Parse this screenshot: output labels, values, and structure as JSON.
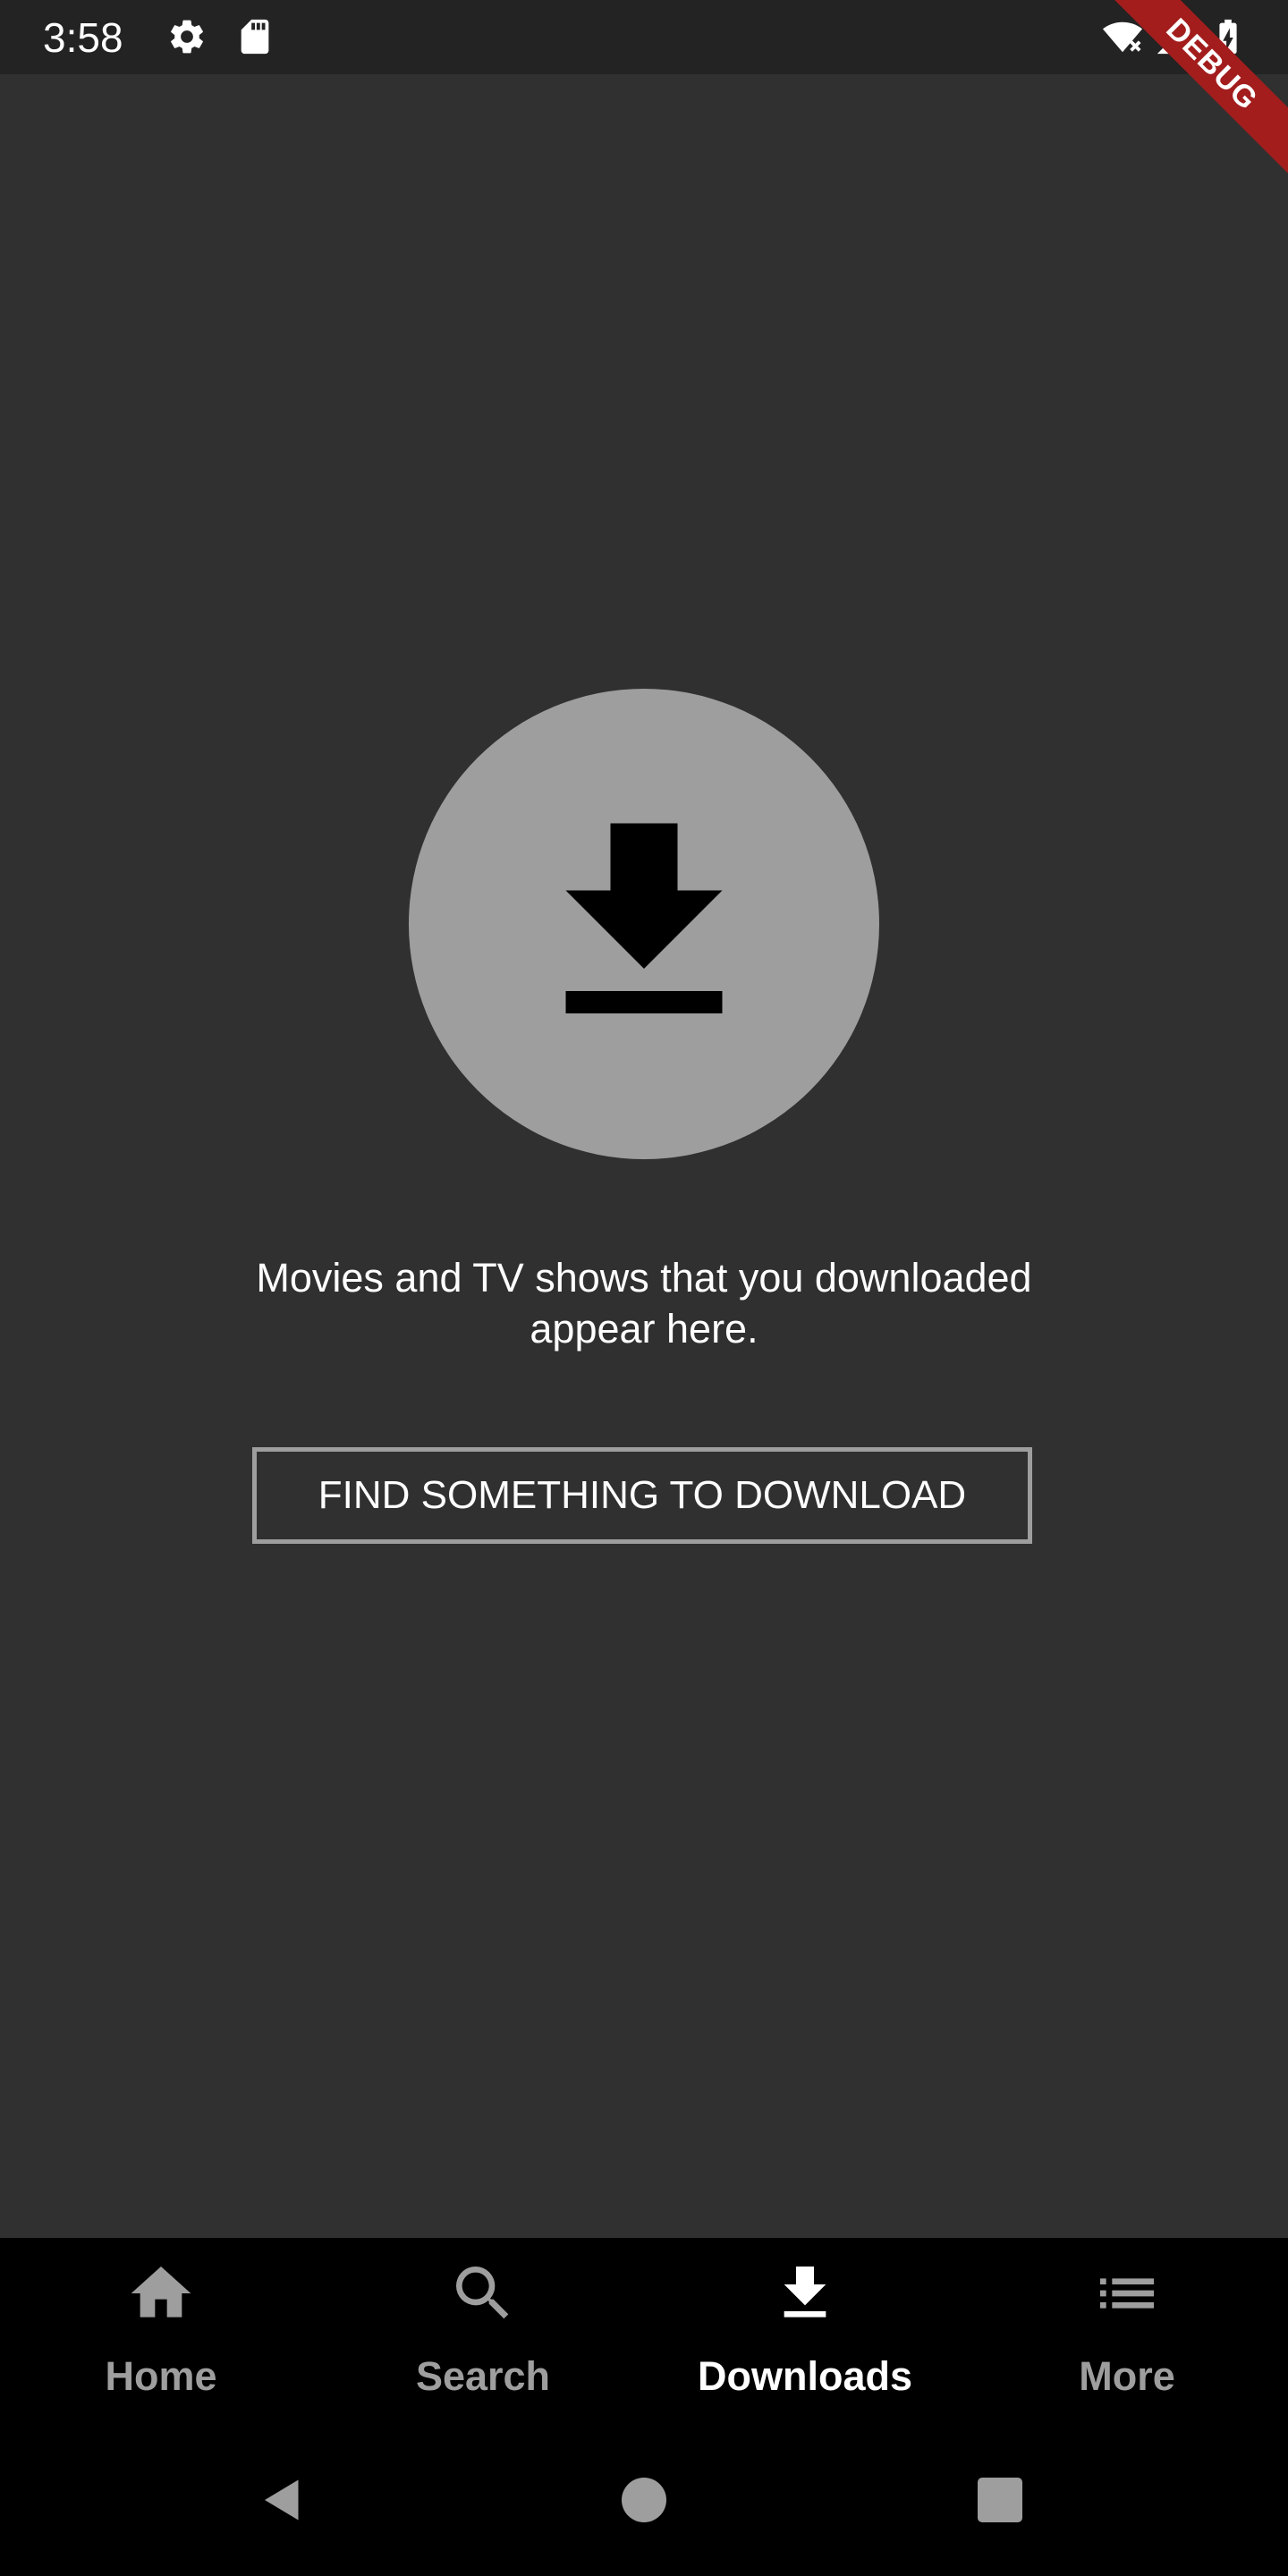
{
  "status_bar": {
    "time": "3:58",
    "icons": [
      "gear-icon",
      "sd-card-icon",
      "wifi-icon",
      "signal-icon",
      "battery-charging-icon"
    ]
  },
  "debug_banner": {
    "label": "DEBUG",
    "color": "#a31d1d"
  },
  "main": {
    "icon": "download-icon",
    "message": "Movies and TV shows that you downloaded appear here.",
    "find_button_label": "FIND SOMETHING TO DOWNLOAD",
    "circle_color": "#9e9e9e",
    "background_color": "#303030"
  },
  "bottom_nav": {
    "items": [
      {
        "label": "Home",
        "icon": "home-icon",
        "active": false
      },
      {
        "label": "Search",
        "icon": "search-icon",
        "active": false
      },
      {
        "label": "Downloads",
        "icon": "download-icon",
        "active": true
      },
      {
        "label": "More",
        "icon": "list-icon",
        "active": false
      }
    ],
    "active_color": "#ffffff",
    "inactive_color": "#9e9e9e"
  },
  "system_nav": {
    "buttons": [
      "back-icon",
      "home-circle-icon",
      "recents-icon"
    ]
  }
}
